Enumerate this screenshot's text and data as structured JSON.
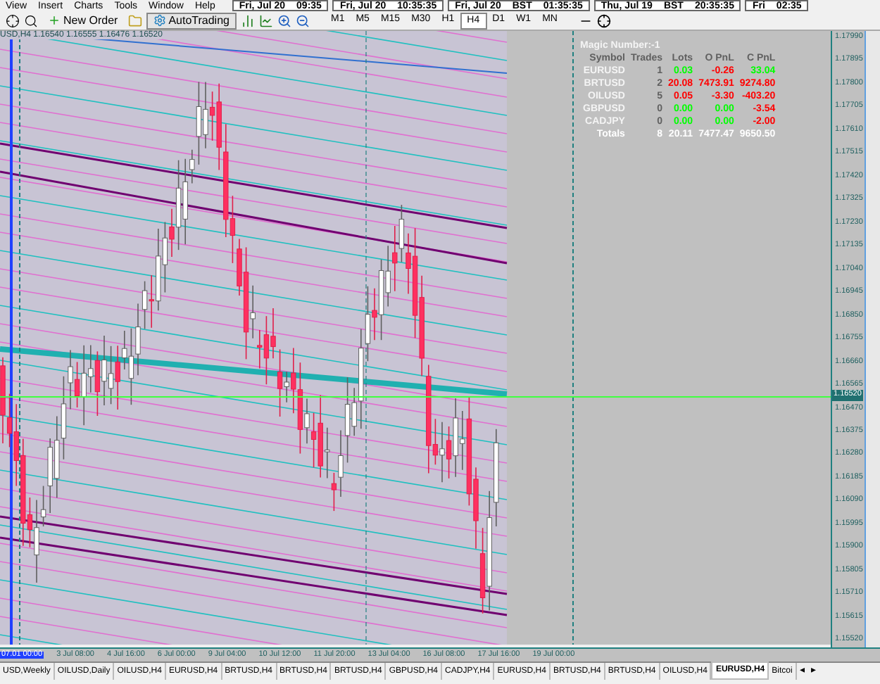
{
  "menu": [
    "View",
    "Insert",
    "Charts",
    "Tools",
    "Window",
    "Help"
  ],
  "clocks": [
    {
      "date": "Fri, Jul 20",
      "time": "09:35"
    },
    {
      "date": "Fri, Jul 20",
      "time": "10:35:35"
    },
    {
      "date": "Fri, Jul 20",
      "zone": "BST",
      "time": "01:35:35"
    },
    {
      "date": "Thu, Jul 19",
      "zone": "BST",
      "time": "20:35:35"
    },
    {
      "date": "Fri",
      "time": "02:35"
    }
  ],
  "toolbar": {
    "new_order": "New Order",
    "auto_trading": "AutoTrading",
    "timeframes": [
      {
        "label": "M1",
        "selected": false
      },
      {
        "label": "M5",
        "selected": false
      },
      {
        "label": "M15",
        "selected": false
      },
      {
        "label": "M30",
        "selected": false
      },
      {
        "label": "H1",
        "selected": false
      },
      {
        "label": "H4",
        "selected": true
      },
      {
        "label": "D1",
        "selected": false
      },
      {
        "label": "W1",
        "selected": false
      },
      {
        "label": "MN",
        "selected": false
      }
    ]
  },
  "chart": {
    "header": "USD,H4 1.16540 1.16555 1.16476 1.16520",
    "info_panel": {
      "title": "Magic Number:-1",
      "columns": [
        "Symbol",
        "Trades",
        "Lots",
        "O PnL",
        "C PnL"
      ],
      "rows": [
        {
          "symbol": "EURUSD",
          "trades": "1",
          "lots": {
            "text": "0.03",
            "color": "#00ff00"
          },
          "open_pnl": {
            "text": "-0.26",
            "color": "#ff0000"
          },
          "closed_pnl": {
            "text": "33.04",
            "color": "#00ff00"
          }
        },
        {
          "symbol": "BRTUSD",
          "trades": "2",
          "lots": {
            "text": "20.08",
            "color": "#ff0000"
          },
          "open_pnl": {
            "text": "7473.91",
            "color": "#ff0000"
          },
          "closed_pnl": {
            "text": "9274.80",
            "color": "#ff0000"
          }
        },
        {
          "symbol": "OILUSD",
          "trades": "5",
          "lots": {
            "text": "0.05",
            "color": "#ff0000"
          },
          "open_pnl": {
            "text": "-3.30",
            "color": "#ff0000"
          },
          "closed_pnl": {
            "text": "-403.20",
            "color": "#ff0000"
          }
        },
        {
          "symbol": "GBPUSD",
          "trades": "0",
          "lots": {
            "text": "0.00",
            "color": "#00ff00"
          },
          "open_pnl": {
            "text": "0.00",
            "color": "#00ff00"
          },
          "closed_pnl": {
            "text": "-3.54",
            "color": "#ff0000"
          }
        },
        {
          "symbol": "CADJPY",
          "trades": "0",
          "lots": {
            "text": "0.00",
            "color": "#00ff00"
          },
          "open_pnl": {
            "text": "0.00",
            "color": "#00ff00"
          },
          "closed_pnl": {
            "text": "-2.00",
            "color": "#ff0000"
          }
        }
      ],
      "totals": {
        "label": "Totals",
        "trades": "8",
        "lots": "20.11",
        "open_pnl": "7477.47",
        "closed_pnl": "9650.50"
      }
    }
  },
  "price_axis": {
    "labels": [
      "1.17990",
      "1.17895",
      "1.17800",
      "1.17705",
      "1.17610",
      "1.17515",
      "1.17420",
      "1.17325",
      "1.17230",
      "1.17135",
      "1.17040",
      "1.16945",
      "1.16850",
      "1.16755",
      "1.16660",
      "1.16565",
      "1.16470",
      "1.16375",
      "1.16280",
      "1.16185",
      "1.16090",
      "1.15995",
      "1.15900",
      "1.15805",
      "1.15710",
      "1.15615",
      "1.15520"
    ],
    "current": "1.16520"
  },
  "time_axis": [
    {
      "label": "07.01 00:00",
      "selected": true
    },
    {
      "label": "3 Jul 08:00",
      "selected": false
    },
    {
      "label": "4 Jul 16:00",
      "selected": false
    },
    {
      "label": "6 Jul 00:00",
      "selected": false
    },
    {
      "label": "9 Jul 04:00",
      "selected": false
    },
    {
      "label": "10 Jul 12:00",
      "selected": false
    },
    {
      "label": "11 Jul 20:00",
      "selected": false
    },
    {
      "label": "13 Jul 04:00",
      "selected": false
    },
    {
      "label": "16 Jul 08:00",
      "selected": false
    },
    {
      "label": "17 Jul 16:00",
      "selected": false
    },
    {
      "label": "19 Jul 00:00",
      "selected": false
    }
  ],
  "tabs": [
    {
      "label": "USD,Weekly",
      "selected": false
    },
    {
      "label": "OILUSD,Daily",
      "selected": false
    },
    {
      "label": "OILUSD,H4",
      "selected": false
    },
    {
      "label": "EURUSD,H4",
      "selected": false
    },
    {
      "label": "BRTUSD,H4",
      "selected": false
    },
    {
      "label": "BRTUSD,H4",
      "selected": false
    },
    {
      "label": "BRTUSD,H4",
      "selected": false
    },
    {
      "label": "GBPUSD,H4",
      "selected": false
    },
    {
      "label": "CADJPY,H4",
      "selected": false
    },
    {
      "label": "EURUSD,H4",
      "selected": false
    },
    {
      "label": "BRTUSD,H4",
      "selected": false
    },
    {
      "label": "BRTUSD,H4",
      "selected": false
    },
    {
      "label": "OILUSD,H4",
      "selected": false
    },
    {
      "label": "EURUSD,H4",
      "selected": true
    },
    {
      "label": "Bitcoi",
      "selected": false
    }
  ],
  "tab_scroll": [
    "◂",
    "▸"
  ]
}
